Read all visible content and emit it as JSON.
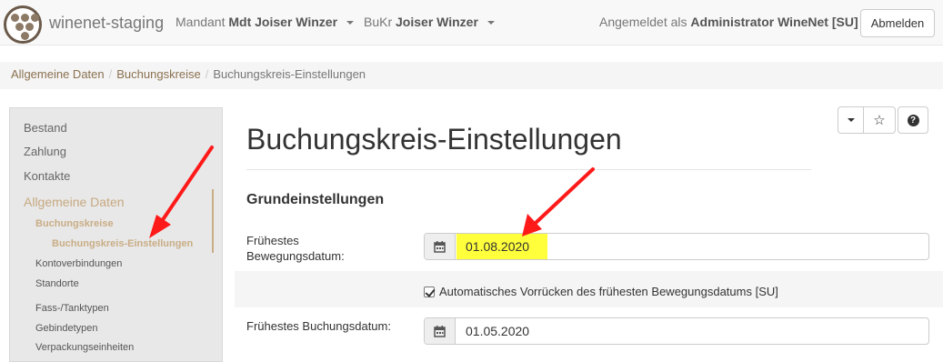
{
  "navbar": {
    "brand": "winenet-staging",
    "mandant_label": "Mandant",
    "mandant_value": "Mdt Joiser Winzer",
    "bukr_label": "BuKr",
    "bukr_value": "Joiser Winzer",
    "logged_prefix": "Angemeldet als",
    "logged_user": "Administrator WineNet [SU]",
    "logout": "Abmelden"
  },
  "breadcrumb": [
    "Allgemeine Daten",
    "Buchungskreise",
    "Buchungskreis-Einstellungen"
  ],
  "sidebar": {
    "items": [
      "Bestand",
      "Zahlung",
      "Kontakte",
      "Allgemeine Daten",
      "Buchungskreise",
      "Buchungskreis-Einstellungen",
      "Kontoverbindungen",
      "Standorte",
      "Fass-/Tanktypen",
      "Gebindetypen",
      "Verpackungseinheiten"
    ]
  },
  "main": {
    "title": "Buchungskreis-Einstellungen",
    "section": "Grundeinstellungen",
    "field1_label_line1": "Frühestes",
    "field1_label_line2": "Bewegungsdatum:",
    "field1_value": "01.08.2020",
    "checkbox_label": "Automatisches Vorrücken des frühesten Bewegungsdatums [SU]",
    "checkbox_checked": true,
    "field2_label": "Frühestes Buchungsdatum:",
    "field2_value": "01.05.2020"
  },
  "toolbar": {
    "icons": [
      "caret-down-icon",
      "star-icon",
      "question-icon"
    ]
  },
  "colors": {
    "accent": "#8a7150",
    "sidebar_active": "#c9ad86",
    "highlight": "#ffff3b",
    "arrow": "#ff1a1a"
  }
}
